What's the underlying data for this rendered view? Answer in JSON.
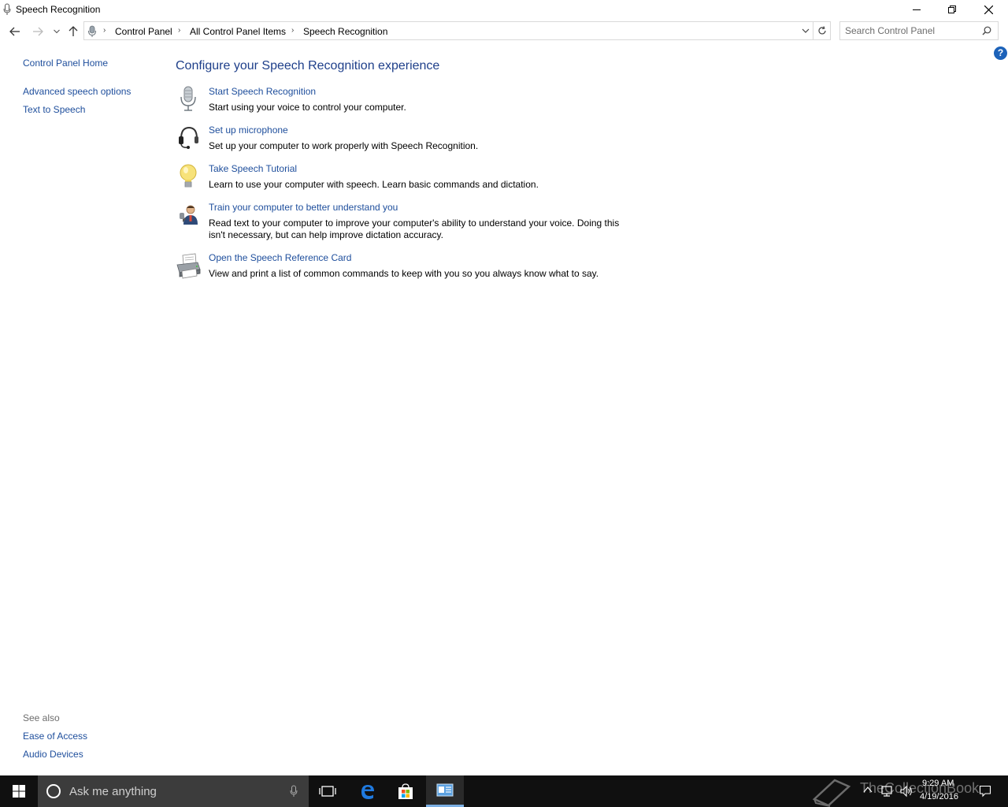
{
  "window": {
    "title": "Speech Recognition"
  },
  "address": {
    "crumbs": [
      "Control Panel",
      "All Control Panel Items",
      "Speech Recognition"
    ]
  },
  "search": {
    "placeholder": "Search Control Panel"
  },
  "help": {
    "label": "?"
  },
  "sidebar": {
    "home": "Control Panel Home",
    "links": [
      "Advanced speech options",
      "Text to Speech"
    ],
    "see_also_title": "See also",
    "see_also": [
      "Ease of Access",
      "Audio Devices"
    ]
  },
  "main": {
    "heading": "Configure your Speech Recognition experience",
    "tasks": [
      {
        "icon": "microphone-icon",
        "link": "Start Speech Recognition",
        "desc": "Start using your voice to control your computer."
      },
      {
        "icon": "headset-icon",
        "link": "Set up microphone",
        "desc": "Set up your computer to work properly with Speech Recognition."
      },
      {
        "icon": "lightbulb-icon",
        "link": "Take Speech Tutorial",
        "desc": "Learn to use your computer with speech.  Learn basic commands and dictation."
      },
      {
        "icon": "user-train-icon",
        "link": "Train your computer to better understand you",
        "desc": "Read text to your computer to improve your computer's ability to understand your voice.  Doing this isn't necessary, but can help improve dictation accuracy."
      },
      {
        "icon": "printer-icon",
        "link": "Open the Speech Reference Card",
        "desc": "View and print a list of common commands to keep with you so you always know what to say."
      }
    ]
  },
  "taskbar": {
    "cortana_placeholder": "Ask me anything",
    "watermark": "TheCollectionBook",
    "time": "9:29 AM",
    "date": "4/19/2016"
  },
  "colors": {
    "link": "#1e4e9c",
    "heading": "#1e3f8a",
    "taskbar": "#101010",
    "help": "#1c62b9"
  }
}
